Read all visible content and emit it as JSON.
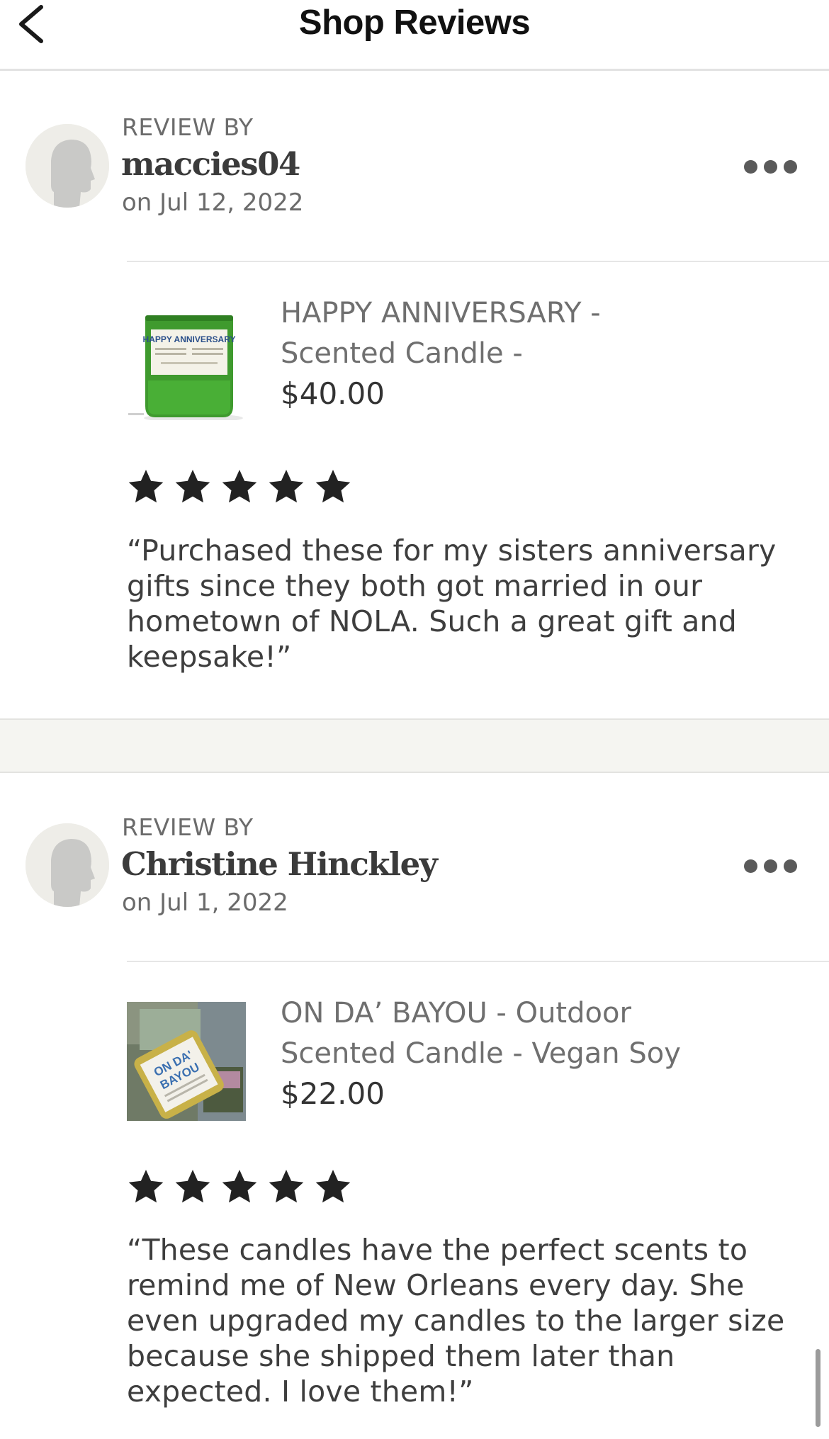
{
  "header": {
    "title": "Shop Reviews",
    "back_icon": "chevron-left-icon"
  },
  "reviews": [
    {
      "review_by_label": "REVIEW BY",
      "reviewer": "maccies04",
      "date": "on Jul 12, 2022",
      "product": {
        "title_line1": "HAPPY ANNIVERSARY -",
        "title_line2": "Scented Candle -",
        "price": "$40.00",
        "label_line1": "HAPPY ANNIVERSARY"
      },
      "rating": 5,
      "text": "“Purchased these for my sisters anniversary gifts since they both got married in our hometown of NOLA. Such a great gift and keepsake!”"
    },
    {
      "review_by_label": "REVIEW BY",
      "reviewer": "Christine Hinckley",
      "date": "on Jul 1, 2022",
      "product": {
        "title_line1": "ON DA’ BAYOU - Outdoor",
        "title_line2": "Scented Candle - Vegan Soy",
        "price": "$22.00",
        "label_line1": "ON DA'",
        "label_line2": "BAYOU"
      },
      "rating": 5,
      "text": "“These candles have the perfect scents to remind me of New Orleans every day. She even upgraded my candles to the larger size because she shipped them later than expected. I love them!”"
    }
  ],
  "icons": {
    "more": "more-horizontal-icon",
    "star": "star-icon",
    "avatar": "default-user-avatar-icon"
  },
  "colors": {
    "star": "#222222",
    "separator": "#f5f5f1",
    "muted_text": "#6f6f6f"
  }
}
